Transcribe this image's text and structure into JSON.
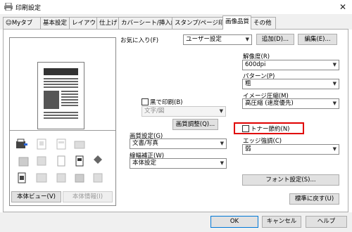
{
  "window": {
    "title": "印刷設定",
    "close_icon": "close-icon"
  },
  "tabs": [
    {
      "label": "Myタブ",
      "icon": "person-icon"
    },
    {
      "label": "基本設定"
    },
    {
      "label": "レイアウト"
    },
    {
      "label": "仕上げ"
    },
    {
      "label": "カバーシート/挿入紙"
    },
    {
      "label": "スタンプ/ページ印字"
    },
    {
      "label": "画像品質",
      "active": true
    },
    {
      "label": "その他"
    }
  ],
  "favorites": {
    "label": "お気に入り(F)",
    "value": "ユーザー設定",
    "add_label": "追加(D)...",
    "edit_label": "編集(E)..."
  },
  "left": {
    "view_button": "本体ビュー(V)",
    "info_button": "本体情報(I)"
  },
  "middle": {
    "mono_label": "黒で印刷(B)",
    "mono_value": "文字/図",
    "quality_button": "画質調整(Q)...",
    "quality_setting_label": "画質設定(G)",
    "quality_setting_value": "文書/写真",
    "line_label": "線幅補正(W)",
    "line_value": "本体設定"
  },
  "right": {
    "resolution_label": "解像度(R)",
    "resolution_value": "600dpi",
    "pattern_label": "パターン(P)",
    "pattern_value": "粗",
    "compress_label": "イメージ圧縮(M)",
    "compress_value": "高圧縮 (速度優先)",
    "toner_label": "トナー節約(N)",
    "edge_label": "エッジ強調(C)",
    "edge_value": "弱",
    "font_button": "フォント設定(S)..."
  },
  "restore_button": "標準に戻す(U)",
  "footer": {
    "ok": "OK",
    "cancel": "キャンセル",
    "help": "ヘルプ"
  },
  "colors": {
    "highlight": "#e00000",
    "accent": "#0078d7"
  }
}
